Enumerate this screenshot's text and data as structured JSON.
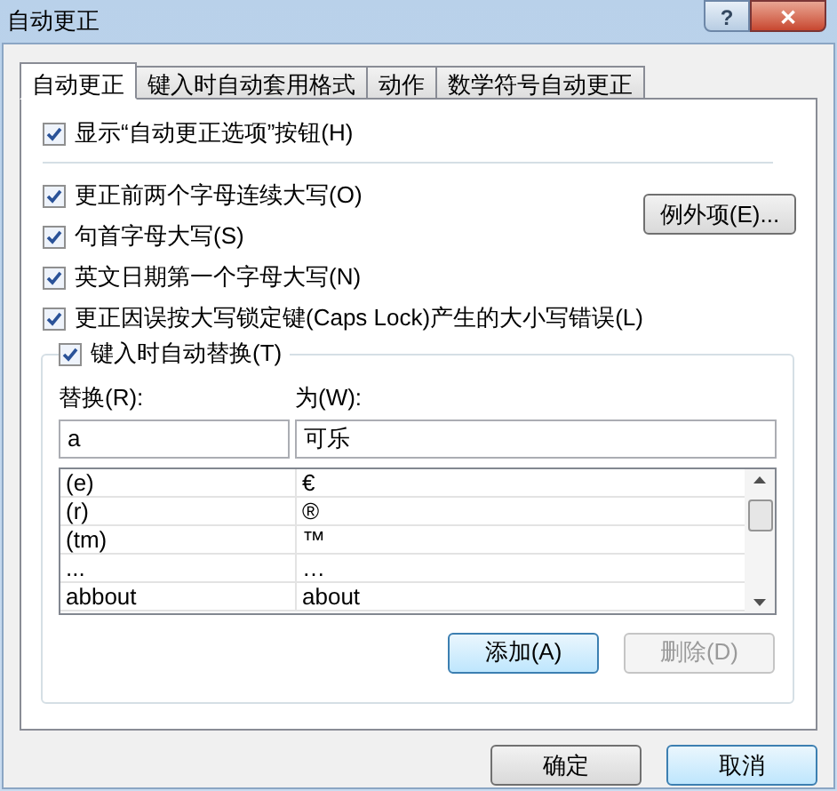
{
  "window": {
    "title": "自动更正",
    "help": "?",
    "close": "✕"
  },
  "tabs": [
    {
      "label": "自动更正",
      "selected": true
    },
    {
      "label": "键入时自动套用格式",
      "selected": false
    },
    {
      "label": "动作",
      "selected": false
    },
    {
      "label": "数学符号自动更正",
      "selected": false
    }
  ],
  "show_button_option": {
    "label": "显示“自动更正选项”按钮(H)",
    "checked": true
  },
  "options": [
    {
      "label": "更正前两个字母连续大写(O)",
      "checked": true
    },
    {
      "label": "句首字母大写(S)",
      "checked": true
    },
    {
      "label": "英文日期第一个字母大写(N)",
      "checked": true
    },
    {
      "label": "更正因误按大写锁定键(Caps Lock)产生的大小写错误(L)",
      "checked": true
    }
  ],
  "exceptions_button": "例外项(E)...",
  "replace_group": {
    "label": "键入时自动替换(T)",
    "checked": true,
    "replace_label": "替换(R):",
    "with_label": "为(W):",
    "replace_value": "a",
    "with_value": "可乐",
    "rows": [
      {
        "replace": "(e)",
        "with": "€"
      },
      {
        "replace": "(r)",
        "with": "®"
      },
      {
        "replace": "(tm)",
        "with": "™"
      },
      {
        "replace": "...",
        "with": "…"
      },
      {
        "replace": "abbout",
        "with": "about"
      }
    ],
    "buttons": [
      {
        "label": "添加(A)",
        "disabled": false,
        "highlighted": true
      },
      {
        "label": "删除(D)",
        "disabled": true
      }
    ]
  },
  "footer_buttons": [
    {
      "label": "确定",
      "highlighted": false
    },
    {
      "label": "取消",
      "highlighted": true
    }
  ]
}
